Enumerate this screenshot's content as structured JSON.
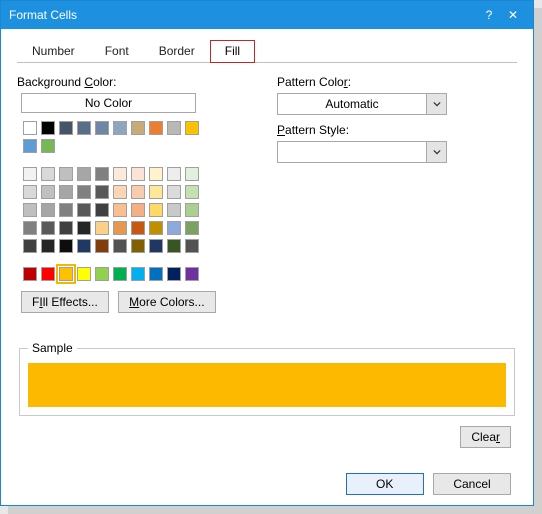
{
  "window": {
    "title": "Format Cells",
    "help": "?",
    "close": "✕"
  },
  "tabs": [
    {
      "label": "Number"
    },
    {
      "label": "Font"
    },
    {
      "label": "Border"
    },
    {
      "label": "Fill",
      "active": true
    }
  ],
  "left": {
    "bg_label_pre": "Background ",
    "bg_label_u": "C",
    "bg_label_post": "olor:",
    "no_color": "No Color",
    "fill_effects_u": "I",
    "fill_effects_pre": "Fill Effects...",
    "more_colors_u": "M",
    "more_colors_pre": "ore Colors..."
  },
  "right": {
    "pattern_color_label_pre": "Pattern Colo",
    "pattern_color_u": "r",
    "pattern_color_label_post": ":",
    "pattern_color_value": "Automatic",
    "pattern_style_u": "P",
    "pattern_style_label": "attern Style:",
    "pattern_style_value": ""
  },
  "sample": {
    "label": "Sample",
    "color": "#fcb900"
  },
  "buttons": {
    "clear": "Clea",
    "clear_u": "r",
    "ok": "OK",
    "cancel": "Cancel"
  },
  "palette_top": [
    "#ffffff",
    "#000000",
    "#44546a",
    "#5b6e88",
    "#6f86a6",
    "#8fa4bf",
    "#c8a97a",
    "#ed7d31",
    "#b8b8b8",
    "#ffc000",
    "#5d9cd5",
    "#77b756"
  ],
  "palette_grid": [
    "#f2f2f2",
    "#d9d9d9",
    "#bfbfbf",
    "#a6a6a6",
    "#808080",
    "#fde9d9",
    "#fbe4d5",
    "#fff2cc",
    "#ededed",
    "#e2efda",
    "#d9d9d9",
    "#bfbfbf",
    "#a6a6a6",
    "#808080",
    "#595959",
    "#fcd5b4",
    "#f8cbad",
    "#ffe699",
    "#dbdbdb",
    "#c6e0b4",
    "#bfbfbf",
    "#a6a6a6",
    "#808080",
    "#595959",
    "#404040",
    "#fabf8f",
    "#f4b084",
    "#ffd966",
    "#c9c9c9",
    "#a9d08e",
    "#808080",
    "#595959",
    "#404040",
    "#262626",
    "#fbd087",
    "#e69850",
    "#c65911",
    "#bf8f00",
    "#8ea9db",
    "#7ca163",
    "#404040",
    "#262626",
    "#0d0d0d",
    "#1f3864",
    "#833c0c",
    "#525252",
    "#806000",
    "#203764",
    "#375623",
    "#525252"
  ],
  "palette_std": [
    "#c00000",
    "#ff0000",
    "#ffc000",
    "#ffff00",
    "#92d050",
    "#00b050",
    "#00b0f0",
    "#0070c0",
    "#002060",
    "#7030a0"
  ],
  "selected_color": "#ffc000"
}
